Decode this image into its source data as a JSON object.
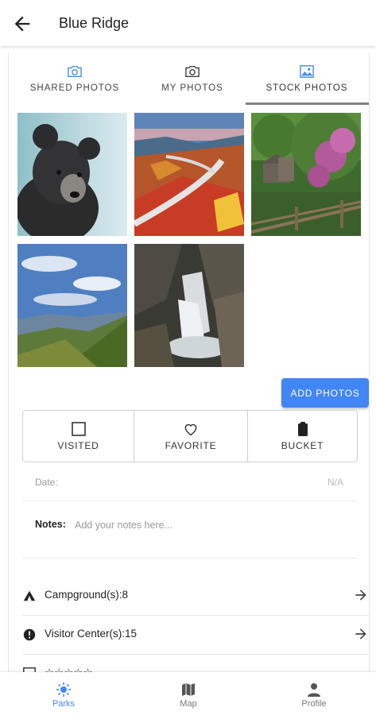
{
  "appbar": {
    "title": "Blue Ridge",
    "back_icon": "arrow-back-icon"
  },
  "tabs": [
    {
      "label": "SHARED PHOTOS",
      "icon": "camera-icon",
      "color": "#4a90e2"
    },
    {
      "label": "MY PHOTOS",
      "icon": "camera-icon",
      "color": "#444444"
    },
    {
      "label": "STOCK PHOTOS",
      "icon": "image-icon",
      "color": "#4a90e2",
      "active": true
    }
  ],
  "photos": [
    {
      "subject": "black bear cub"
    },
    {
      "subject": "linn cove viaduct in autumn"
    },
    {
      "subject": "mabry mill with rhododendron"
    },
    {
      "subject": "blue ridge mountain vista"
    },
    {
      "subject": "waterfall in rocky gorge"
    }
  ],
  "add_photos": {
    "label": "ADD PHOTOS",
    "color": "#4285f4"
  },
  "status_buttons": [
    {
      "label": "VISITED",
      "icon": "checkbox-outline-icon"
    },
    {
      "label": "FAVORITE",
      "icon": "heart-outline-icon"
    },
    {
      "label": "BUCKET",
      "icon": "clipboard-icon"
    }
  ],
  "date": {
    "label": "Date:",
    "value": "N/A"
  },
  "notes": {
    "label": "Notes:",
    "placeholder": "Add your notes here..."
  },
  "info_rows": [
    {
      "label": "Campground(s):8",
      "icon": "tent-icon"
    },
    {
      "label": "Visitor Center(s):15",
      "icon": "info-circle-icon"
    },
    {
      "label": "☆☆☆☆☆",
      "icon": "checkbox-icon"
    }
  ],
  "bottom_nav": [
    {
      "label": "Parks",
      "icon": "sun-icon",
      "active": true,
      "color": "#4285f4"
    },
    {
      "label": "Map",
      "icon": "map-icon"
    },
    {
      "label": "Profile",
      "icon": "person-icon"
    }
  ]
}
